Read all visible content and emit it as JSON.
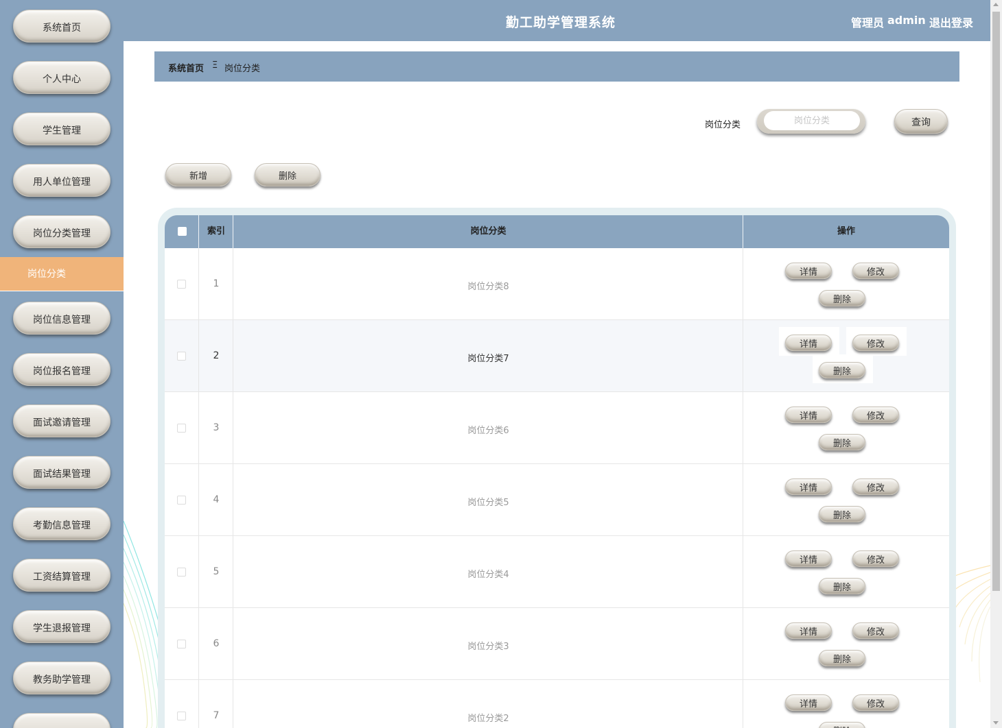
{
  "app": {
    "title": "勤工助学管理系统"
  },
  "user": {
    "role": "管理员",
    "name": "admin",
    "logout": "退出登录"
  },
  "sidebar": {
    "items_top": [
      {
        "label": "系统首页"
      },
      {
        "label": "个人中心"
      },
      {
        "label": "学生管理"
      },
      {
        "label": "用人单位管理"
      },
      {
        "label": "岗位分类管理"
      }
    ],
    "active": {
      "label": "岗位分类"
    },
    "items_bottom": [
      {
        "label": "岗位信息管理"
      },
      {
        "label": "岗位报名管理"
      },
      {
        "label": "面试邀请管理"
      },
      {
        "label": "面试结果管理"
      },
      {
        "label": "考勤信息管理"
      },
      {
        "label": "工资结算管理"
      },
      {
        "label": "学生退报管理"
      },
      {
        "label": "教务助学管理"
      },
      {
        "label": "..."
      }
    ]
  },
  "breadcrumb": {
    "home": "系统首页",
    "separator": "Ξ",
    "current": "岗位分类"
  },
  "search": {
    "label": "岗位分类",
    "placeholder": "岗位分类",
    "value": "",
    "button": "查询"
  },
  "actions": {
    "add": "新增",
    "delete": "删除"
  },
  "table": {
    "headers": {
      "index": "索引",
      "category": "岗位分类",
      "actions": "操作"
    },
    "row_buttons": {
      "detail": "详情",
      "edit": "修改",
      "delete": "删除"
    },
    "rows": [
      {
        "index": "1",
        "category": "岗位分类8"
      },
      {
        "index": "2",
        "category": "岗位分类7"
      },
      {
        "index": "3",
        "category": "岗位分类6"
      },
      {
        "index": "4",
        "category": "岗位分类5"
      },
      {
        "index": "5",
        "category": "岗位分类4"
      },
      {
        "index": "6",
        "category": "岗位分类3"
      },
      {
        "index": "7",
        "category": "岗位分类2"
      }
    ]
  },
  "colors": {
    "primary": "#88a3be",
    "active": "#f0b47a",
    "frame": "#e3eef1"
  }
}
